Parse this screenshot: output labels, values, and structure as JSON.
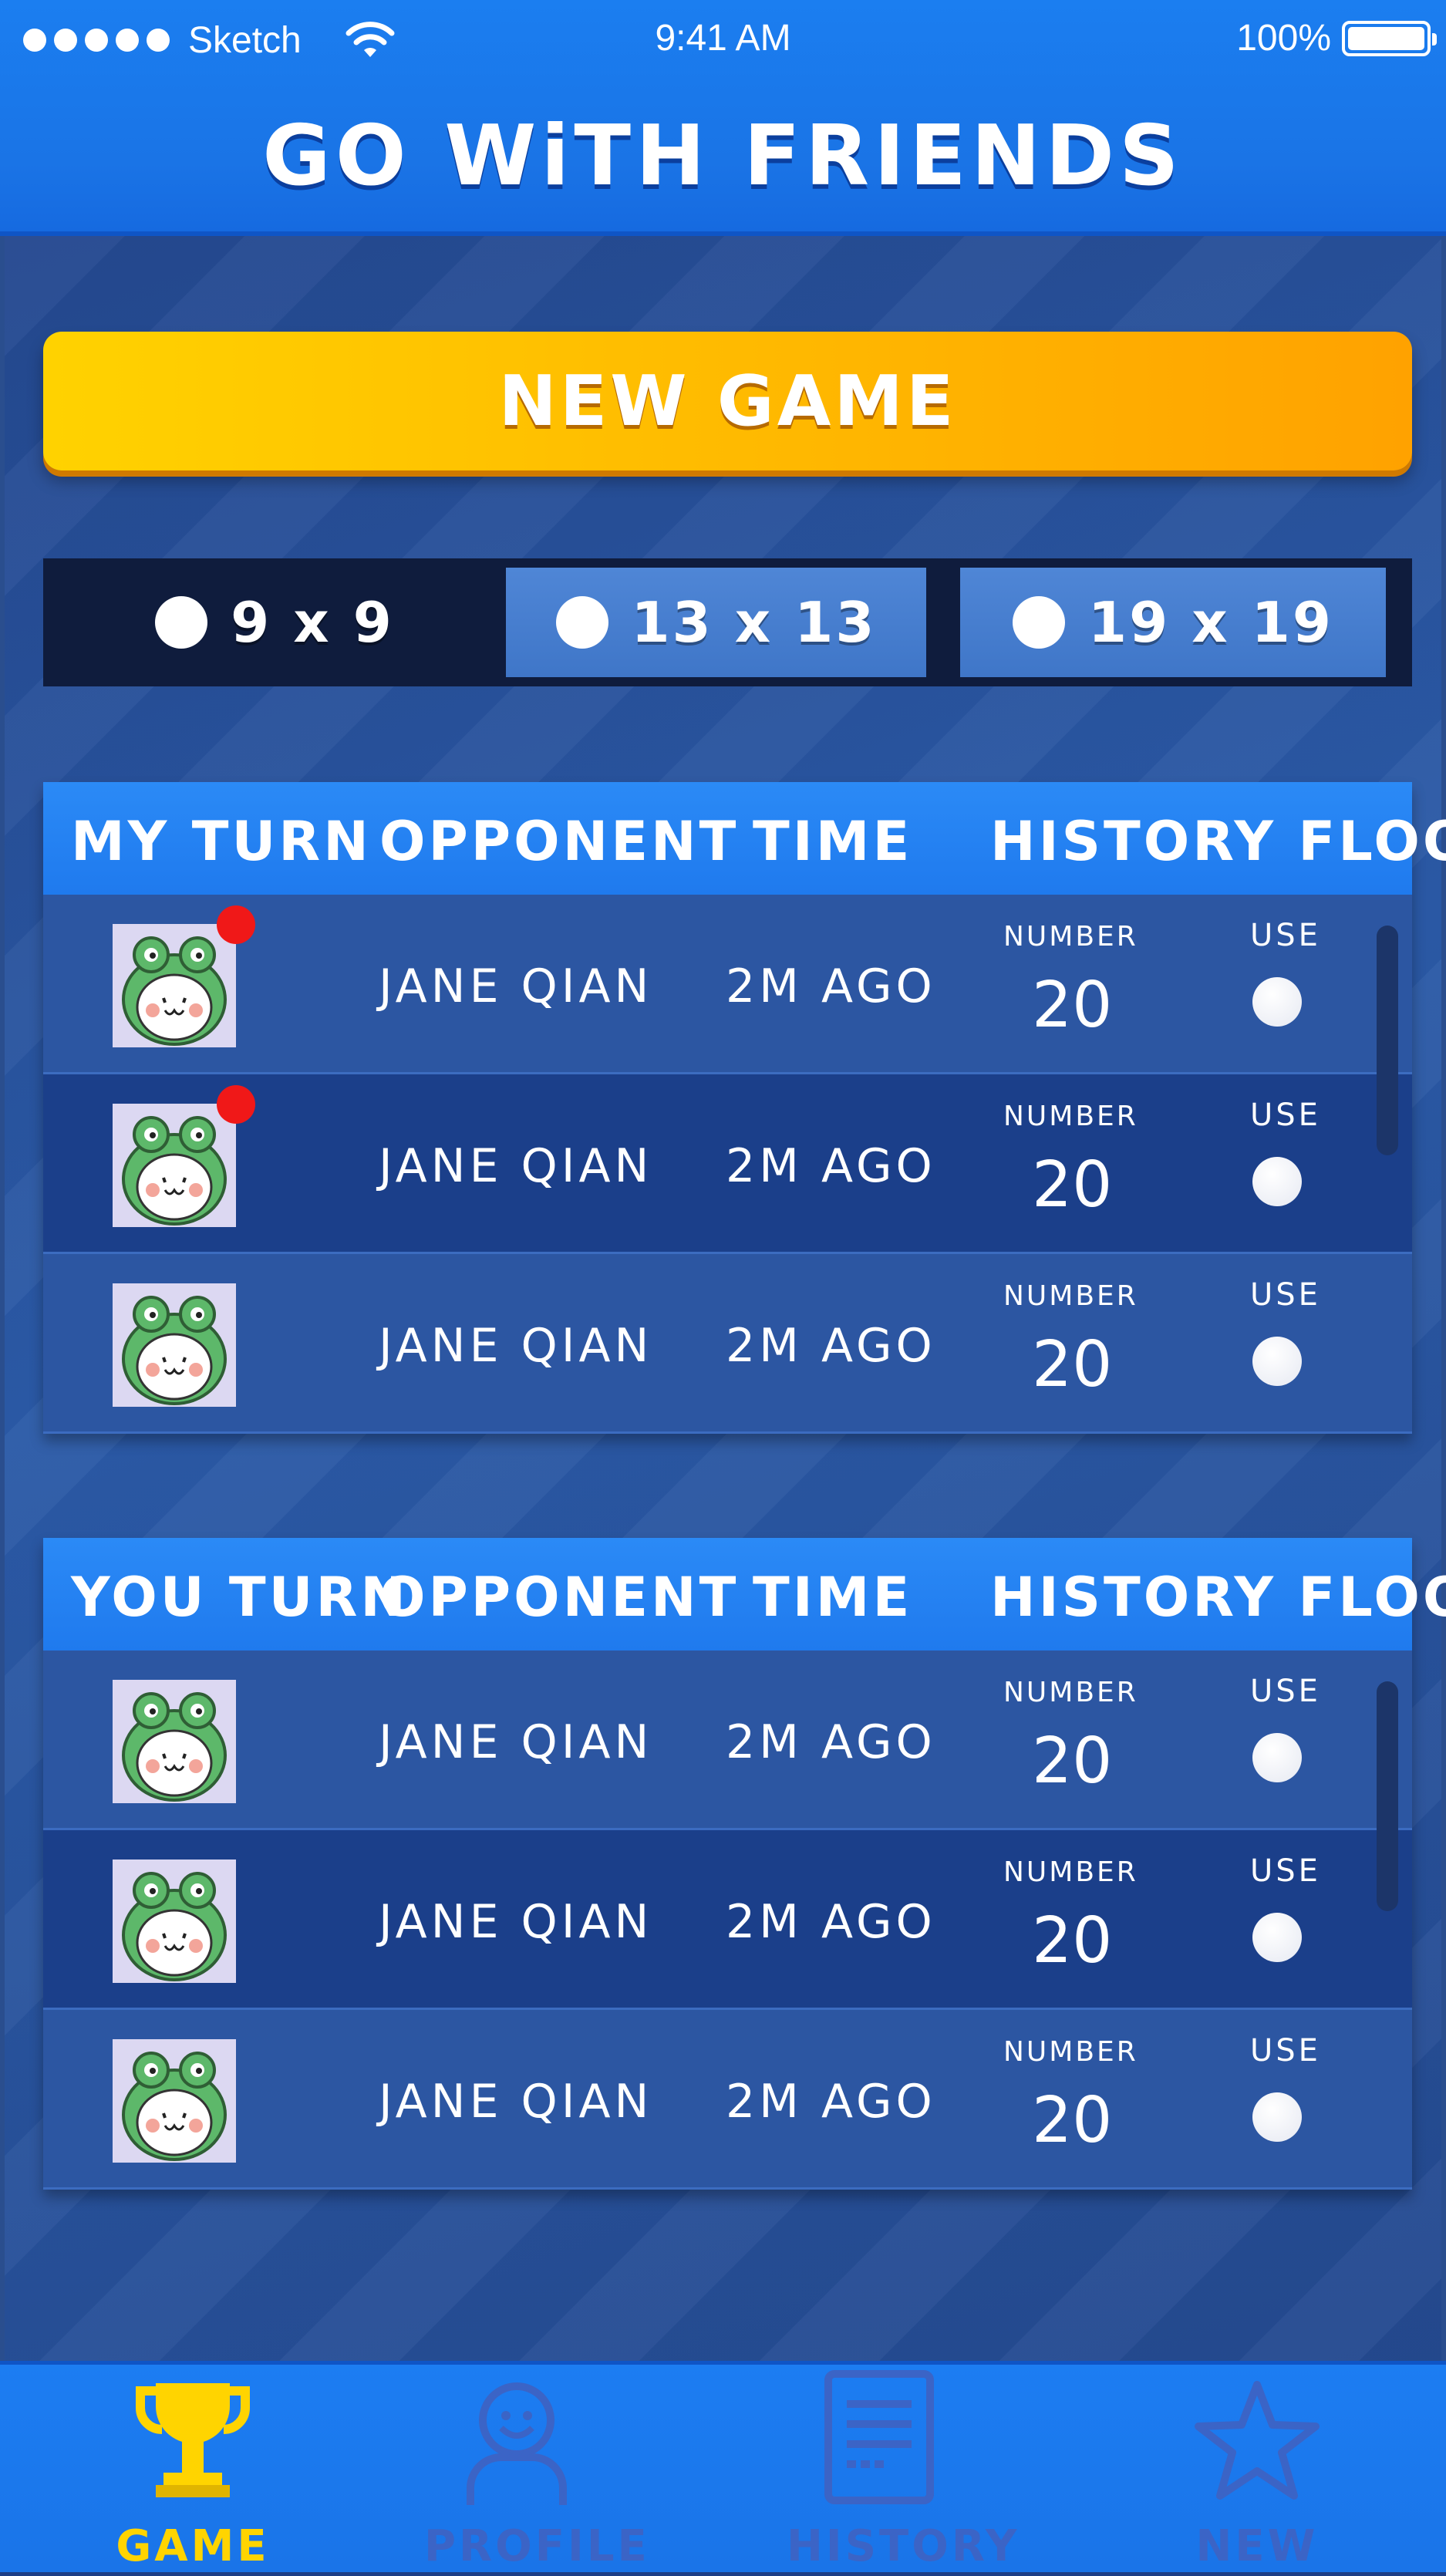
{
  "status_bar": {
    "carrier": "Sketch",
    "time": "9:41 AM",
    "battery": "100%"
  },
  "app_title": "GO WiTH FRIENDS",
  "new_game_label": "NEW GAME",
  "board_sizes": [
    {
      "label": "9 x 9",
      "selected": true
    },
    {
      "label": "13 x 13",
      "selected": false
    },
    {
      "label": "19 x 19",
      "selected": false
    }
  ],
  "my_turn_table": {
    "headers": {
      "turn": "MY TURN",
      "opponent": "OPPONENT",
      "time": "TIME",
      "history": "HISTORY FLOOR"
    },
    "rows": [
      {
        "opponent": "JANE QIAN",
        "time": "2M AGO",
        "number_label": "NUMBER",
        "number": "20",
        "use_label": "USE",
        "notification": true
      },
      {
        "opponent": "JANE QIAN",
        "time": "2M AGO",
        "number_label": "NUMBER",
        "number": "20",
        "use_label": "USE",
        "notification": true
      },
      {
        "opponent": "JANE QIAN",
        "time": "2M AGO",
        "number_label": "NUMBER",
        "number": "20",
        "use_label": "USE",
        "notification": false
      }
    ]
  },
  "you_turn_table": {
    "headers": {
      "turn": "YOU TURN",
      "opponent": "OPPONENT",
      "time": "TIME",
      "history": "HISTORY FLOOR"
    },
    "rows": [
      {
        "opponent": "JANE QIAN",
        "time": "2M AGO",
        "number_label": "NUMBER",
        "number": "20",
        "use_label": "USE",
        "notification": false
      },
      {
        "opponent": "JANE QIAN",
        "time": "2M AGO",
        "number_label": "NUMBER",
        "number": "20",
        "use_label": "USE",
        "notification": false
      },
      {
        "opponent": "JANE QIAN",
        "time": "2M AGO",
        "number_label": "NUMBER",
        "number": "20",
        "use_label": "USE",
        "notification": false
      }
    ]
  },
  "nav": [
    {
      "label": "GAME",
      "icon": "trophy-icon",
      "active": true
    },
    {
      "label": "PROFILE",
      "icon": "profile-icon",
      "active": false
    },
    {
      "label": "HISTORY",
      "icon": "history-document-icon",
      "active": false
    },
    {
      "label": "NEW",
      "icon": "star-icon",
      "active": false
    }
  ],
  "colors": {
    "accent_yellow": "#ffd200",
    "header_blue": "#1f7aee",
    "notification_red": "#f01818"
  }
}
